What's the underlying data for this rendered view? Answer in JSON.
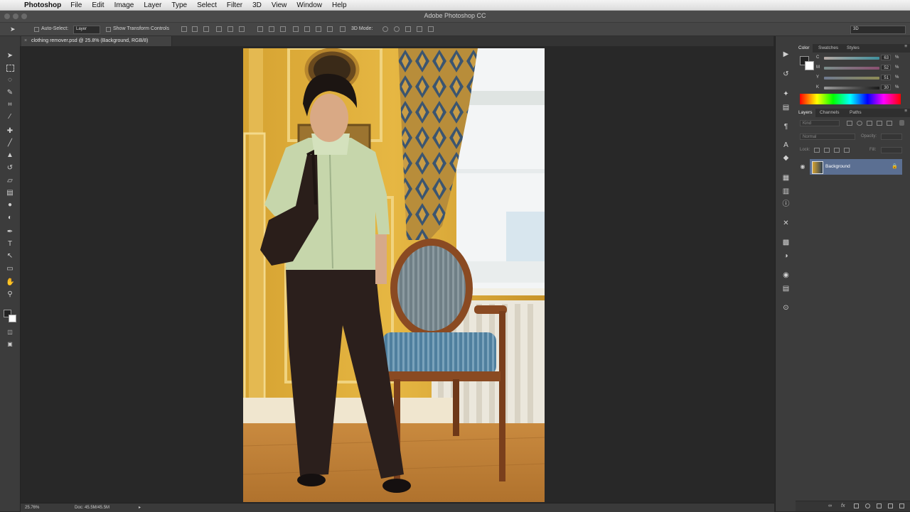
{
  "menubar": {
    "app": "Photoshop",
    "items": [
      "File",
      "Edit",
      "Image",
      "Layer",
      "Type",
      "Select",
      "Filter",
      "3D",
      "View",
      "Window",
      "Help"
    ]
  },
  "window": {
    "title": "Adobe Photoshop CC"
  },
  "options_bar": {
    "auto_select_label": "Auto-Select:",
    "auto_select_value": "Layer",
    "show_transform_label": "Show Transform Controls",
    "mode_3d_label": "3D Mode:",
    "workspace_value": "3D"
  },
  "document": {
    "tab_title": "clothing remover.psd @ 25.8% (Background, RGB/8)",
    "close_glyph": "×"
  },
  "status_bar": {
    "zoom": "25.76%",
    "doc_size": "Doc: 45.5M/45.5M"
  },
  "color_panel": {
    "tabs": [
      "Color",
      "Swatches",
      "Styles"
    ],
    "active_tab": "Color",
    "channels": [
      {
        "label": "C",
        "value": "63",
        "unit": "%"
      },
      {
        "label": "M",
        "value": "52",
        "unit": "%"
      },
      {
        "label": "Y",
        "value": "51",
        "unit": "%"
      },
      {
        "label": "K",
        "value": "30",
        "unit": "%"
      }
    ],
    "foreground_color": "#222222",
    "background_color": "#ffffff"
  },
  "layers_panel": {
    "tabs": [
      "Layers",
      "Channels",
      "Paths"
    ],
    "active_tab": "Layers",
    "kind_label": "Kind",
    "blend_mode": "Normal",
    "opacity_label": "Opacity:",
    "lock_label": "Lock:",
    "fill_label": "Fill:",
    "layers": [
      {
        "name": "Background",
        "visible": true,
        "locked": true,
        "selected": true
      }
    ]
  },
  "icons": {
    "toolbar": [
      "move-tool-icon",
      "marquee-tool-icon",
      "lasso-tool-icon",
      "quick-select-tool-icon",
      "crop-tool-icon",
      "eyedropper-tool-icon",
      "healing-brush-tool-icon",
      "brush-tool-icon",
      "clone-stamp-tool-icon",
      "history-brush-tool-icon",
      "eraser-tool-icon",
      "gradient-tool-icon",
      "blur-tool-icon",
      "dodge-tool-icon",
      "pen-tool-icon",
      "type-tool-icon",
      "path-select-tool-icon",
      "shape-tool-icon",
      "hand-tool-icon",
      "zoom-tool-icon"
    ],
    "dock": [
      "play-icon",
      "history-icon",
      "brush-preset-icon",
      "clone-source-icon",
      "paragraph-icon",
      "character-icon",
      "properties-icon",
      "adjustments-icon",
      "info-icon",
      "tool-presets-icon",
      "3d-icon",
      "swatches-icon",
      "styles-icon",
      "navigator-icon"
    ]
  }
}
